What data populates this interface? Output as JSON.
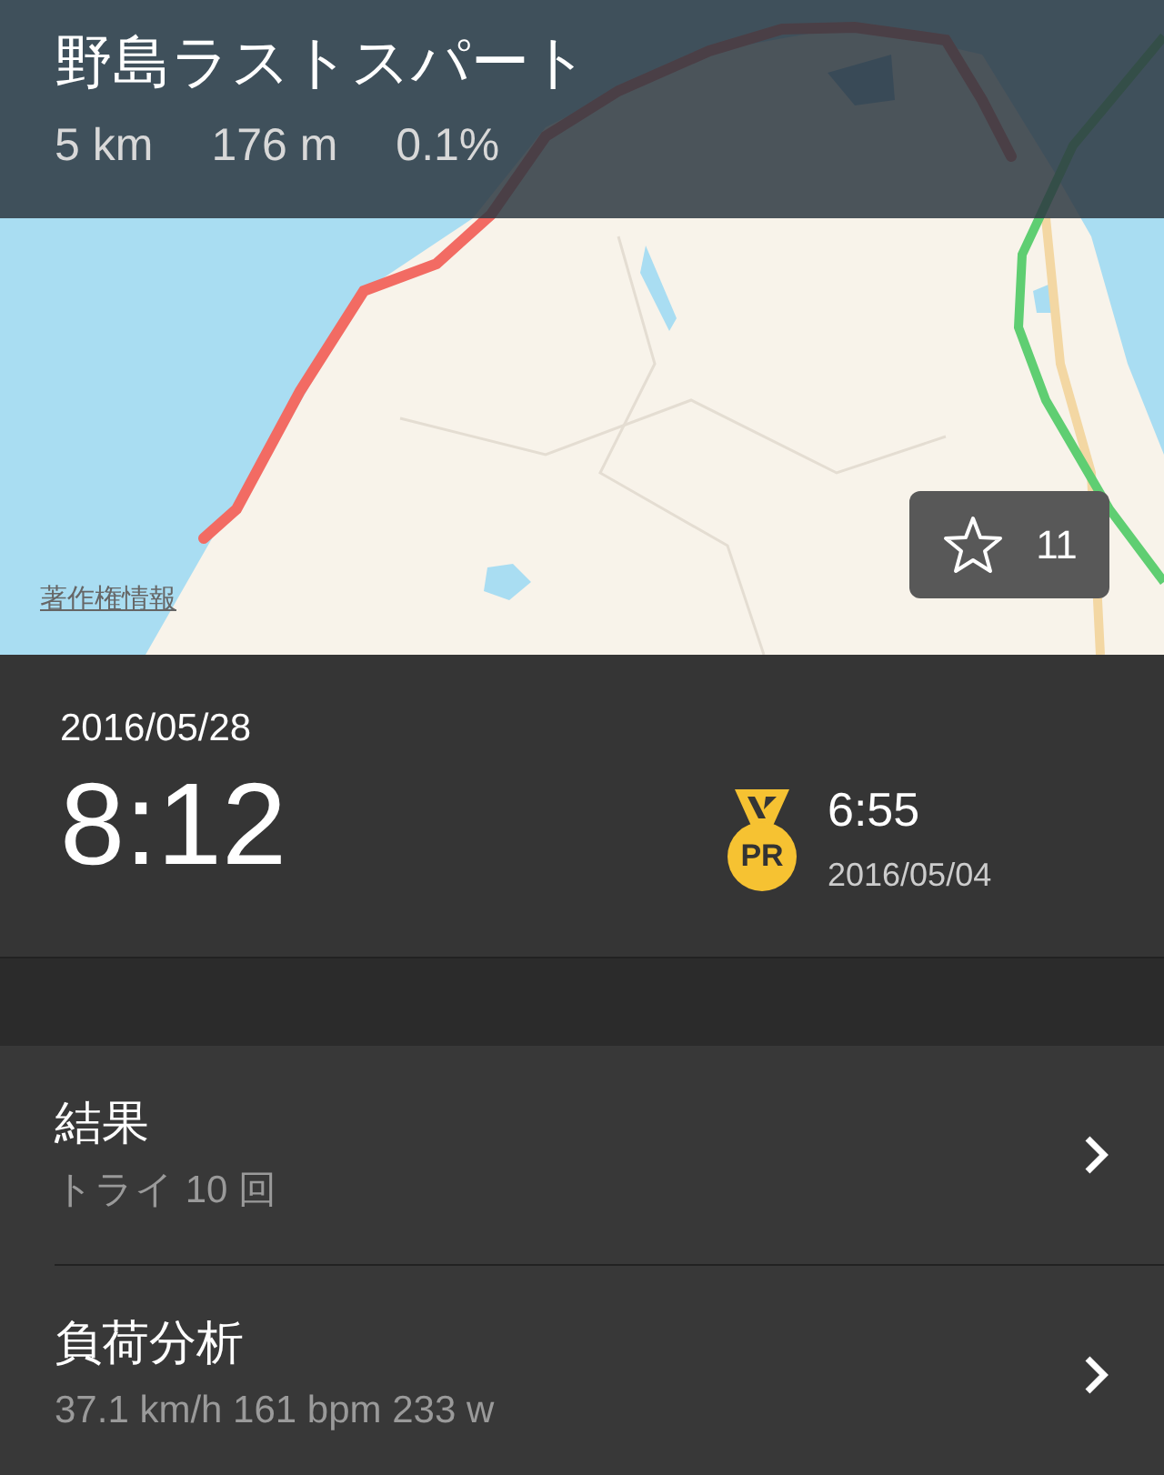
{
  "segment": {
    "title": "野島ラストスパート",
    "stats": [
      "5 km",
      "176 m",
      "0.1%"
    ]
  },
  "map": {
    "kind": "picture",
    "legal_link": "著作権情報",
    "star_button": {
      "label": "11"
    }
  },
  "effort": {
    "date": "2016/05/28",
    "time": "8:12",
    "pr": {
      "badge": "PR",
      "time": "6:55",
      "date": "2016/05/04"
    }
  },
  "rows": [
    {
      "title": "結果",
      "subtitle": "トライ 10 回"
    },
    {
      "title": "負荷分析",
      "subtitle": "37.1 km/h 161 bpm 233 w"
    }
  ]
}
